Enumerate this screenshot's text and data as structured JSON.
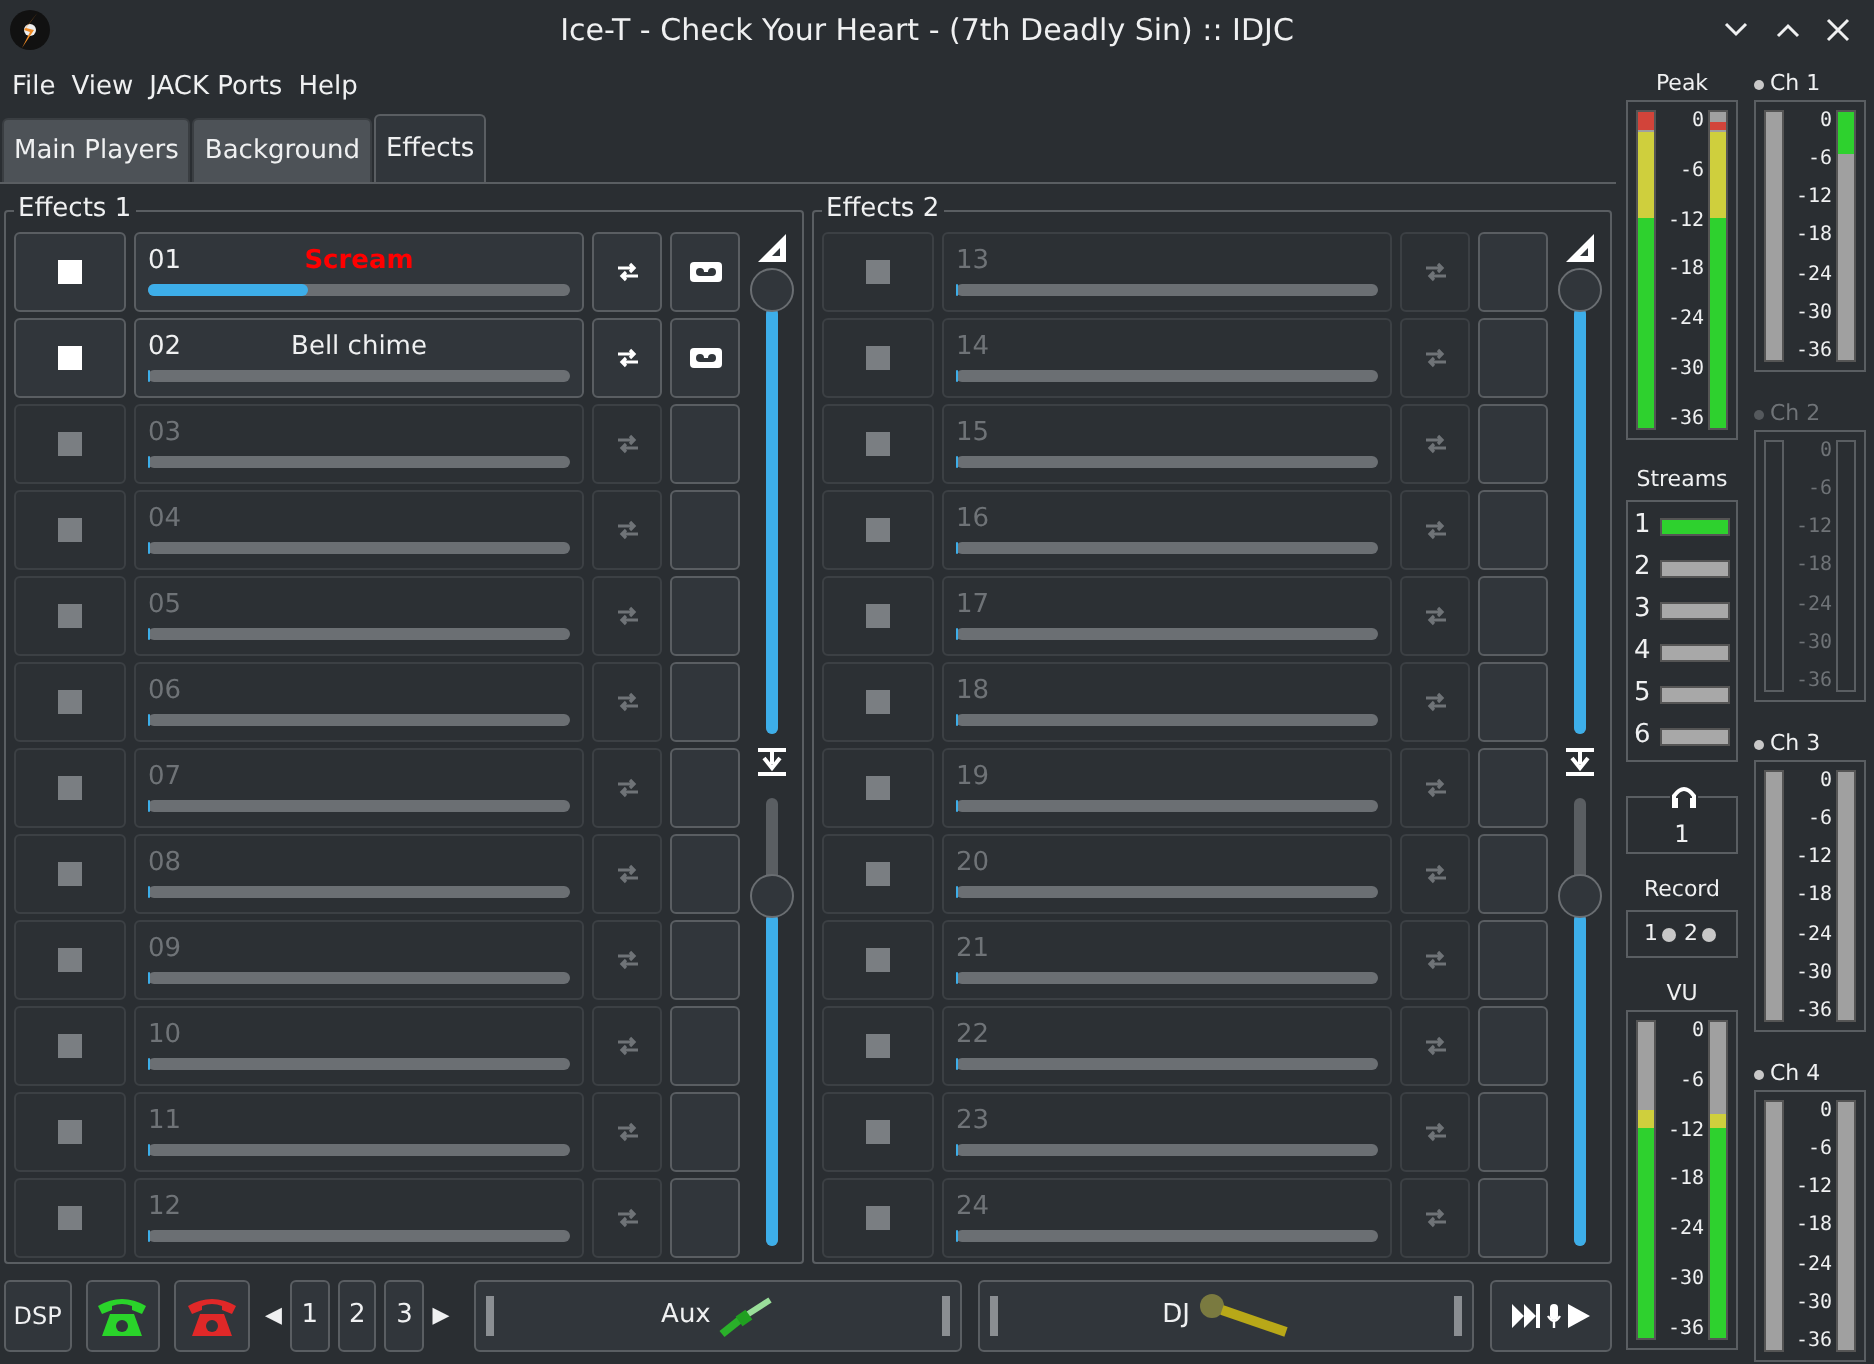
{
  "window": {
    "title": "Ice-T - Check Your Heart - (7th Deadly Sin) :: IDJC"
  },
  "menu": [
    "File",
    "View",
    "JACK Ports",
    "Help"
  ],
  "tabs": [
    {
      "label": "Main Players",
      "selected": false
    },
    {
      "label": "Background",
      "selected": false
    },
    {
      "label": "Effects",
      "selected": true
    }
  ],
  "effect_groups": [
    {
      "title": "Effects 1",
      "volume_slider": {
        "level": 1
      },
      "headroom_slider": {
        "level": 0.78
      },
      "effects": [
        {
          "number": "01",
          "name": "Scream",
          "active": true,
          "playing": true,
          "level": 0.38
        },
        {
          "number": "02",
          "name": "Bell chime",
          "active": true,
          "playing": false,
          "level": 0
        },
        {
          "number": "03",
          "active": false,
          "level": 0
        },
        {
          "number": "04",
          "active": false,
          "level": 0
        },
        {
          "number": "05",
          "active": false,
          "level": 0
        },
        {
          "number": "06",
          "active": false,
          "level": 0
        },
        {
          "number": "07",
          "active": false,
          "level": 0
        },
        {
          "number": "08",
          "active": false,
          "level": 0
        },
        {
          "number": "09",
          "active": false,
          "level": 0
        },
        {
          "number": "10",
          "active": false,
          "level": 0
        },
        {
          "number": "11",
          "active": false,
          "level": 0
        },
        {
          "number": "12",
          "active": false,
          "level": 0
        }
      ]
    },
    {
      "title": "Effects 2",
      "volume_slider": {
        "level": 1
      },
      "headroom_slider": {
        "level": 0.78
      },
      "effects": [
        {
          "number": "13",
          "active": false,
          "level": 0
        },
        {
          "number": "14",
          "active": false,
          "level": 0
        },
        {
          "number": "15",
          "active": false,
          "level": 0
        },
        {
          "number": "16",
          "active": false,
          "level": 0
        },
        {
          "number": "17",
          "active": false,
          "level": 0
        },
        {
          "number": "18",
          "active": false,
          "level": 0
        },
        {
          "number": "19",
          "active": false,
          "level": 0
        },
        {
          "number": "20",
          "active": false,
          "level": 0
        },
        {
          "number": "21",
          "active": false,
          "level": 0
        },
        {
          "number": "22",
          "active": false,
          "level": 0
        },
        {
          "number": "23",
          "active": false,
          "level": 0
        },
        {
          "number": "24",
          "active": false,
          "level": 0
        }
      ]
    }
  ],
  "bottom_bar": {
    "dsp": "DSP",
    "page_prev": "◀",
    "pages": [
      {
        "label": "1",
        "selected": false
      },
      {
        "label": "2",
        "selected": false
      },
      {
        "label": "3",
        "selected": false
      }
    ],
    "page_next": "▶",
    "aux": "Aux",
    "dj": "DJ"
  },
  "peak": {
    "label": "Peak",
    "scale": [
      "0",
      "-6",
      "-12",
      "-18",
      "-24",
      "-30",
      "-36"
    ],
    "bars": [
      {
        "level": 1
      },
      {
        "level": 0.97
      }
    ]
  },
  "streams": {
    "label": "Streams",
    "items": [
      {
        "label": "1",
        "on": true
      },
      {
        "label": "2",
        "on": false
      },
      {
        "label": "3",
        "on": false
      },
      {
        "label": "4",
        "on": false
      },
      {
        "label": "5",
        "on": false
      },
      {
        "label": "6",
        "on": false
      }
    ]
  },
  "headphones": {
    "value": "1"
  },
  "record": {
    "label": "Record",
    "items": [
      {
        "label": "1",
        "on": false
      },
      {
        "label": "2",
        "on": false
      }
    ]
  },
  "vu": {
    "label": "VU",
    "scale": [
      "0",
      "-6",
      "-12",
      "-18",
      "-24",
      "-30",
      "-36"
    ],
    "bars": [
      {
        "level": 0.72
      },
      {
        "level": 0.71
      }
    ]
  },
  "channels": [
    {
      "label": "Ch 1",
      "enabled": true,
      "scale": [
        "0",
        "-6",
        "-12",
        "-18",
        "-24",
        "-30",
        "-36"
      ],
      "bars": [
        {
          "level": 0
        },
        {
          "level": 0.17
        }
      ]
    },
    {
      "label": "Ch 2",
      "enabled": false,
      "scale": [
        "0",
        "-6",
        "-12",
        "-18",
        "-24",
        "-30",
        "-36"
      ],
      "bars": [
        {
          "level": 0
        },
        {
          "level": 0
        }
      ]
    },
    {
      "label": "Ch 3",
      "enabled": true,
      "scale": [
        "0",
        "-6",
        "-12",
        "-18",
        "-24",
        "-30",
        "-36"
      ],
      "bars": [
        {
          "level": 0
        },
        {
          "level": 0
        }
      ]
    },
    {
      "label": "Ch 4",
      "enabled": true,
      "scale": [
        "0",
        "-6",
        "-12",
        "-18",
        "-24",
        "-30",
        "-36"
      ],
      "bars": [
        {
          "level": 0
        },
        {
          "level": 0
        }
      ]
    }
  ]
}
